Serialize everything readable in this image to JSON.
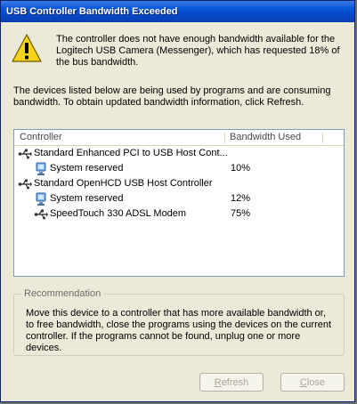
{
  "window": {
    "title": "USB Controller Bandwidth Exceeded"
  },
  "message": {
    "warning": "The controller does not have enough bandwidth available for the Logitech USB Camera (Messenger), which has requested 18% of the bus bandwidth.",
    "info": "The devices listed below are being used by programs and are consuming bandwidth. To obtain updated bandwidth information, click Refresh."
  },
  "list": {
    "columns": [
      "Controller",
      "Bandwidth Used"
    ],
    "rows": [
      {
        "label": "Standard Enhanced PCI to USB Host Cont...",
        "bandwidth": "",
        "icon": "usb-controller-icon"
      },
      {
        "label": "System reserved",
        "bandwidth": "10%",
        "icon": "system-reserved-icon"
      },
      {
        "label": "Standard OpenHCD USB Host Controller",
        "bandwidth": "",
        "icon": "usb-controller-icon"
      },
      {
        "label": "System reserved",
        "bandwidth": "12%",
        "icon": "system-reserved-icon"
      },
      {
        "label": "SpeedTouch 330 ADSL Modem",
        "bandwidth": "75%",
        "icon": "usb-device-icon"
      }
    ]
  },
  "recommendation": {
    "legend": "Recommendation",
    "text": "Move this device to a controller that has more available bandwidth or, to free bandwidth, close the programs using the devices on the current controller. If the programs cannot be found, unplug one or more devices."
  },
  "buttons": {
    "refresh": {
      "underline": "R",
      "rest": "efresh"
    },
    "close": {
      "underline": "C",
      "rest": "lose"
    }
  },
  "colors": {
    "titlebar": "#0a57d8",
    "dialog_bg": "#ece9d8",
    "disabled_text": "#a9a797"
  }
}
